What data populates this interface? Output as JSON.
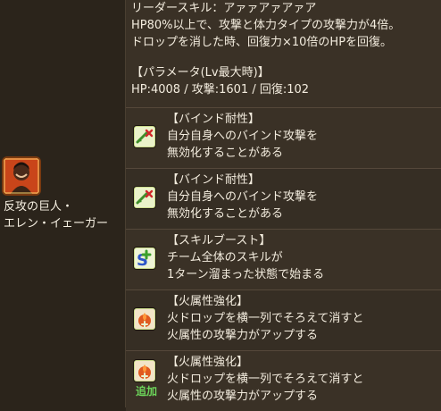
{
  "character": {
    "name_line1": "反攻の巨人・",
    "name_line2": "エレン・イェーガー"
  },
  "leader": {
    "label": "リーダースキル：アァァアァアァア",
    "line1": "HP80%以上で、攻撃と体力タイプの攻撃力が4倍。",
    "line2": "ドロップを消した時、回復力×10倍のHPを回復。"
  },
  "params": {
    "heading": "【パラメータ(Lv最大時)】",
    "stats": "HP:4008 / 攻撃:1601 / 回復:102"
  },
  "awakenings": [
    {
      "icon": "bind-resist-icon",
      "title": "【バインド耐性】",
      "desc1": "自分自身へのバインド攻撃を",
      "desc2": "無効化することがある"
    },
    {
      "icon": "bind-resist-icon",
      "title": "【バインド耐性】",
      "desc1": "自分自身へのバインド攻撃を",
      "desc2": "無効化することがある"
    },
    {
      "icon": "skill-boost-icon",
      "title": "【スキルブースト】",
      "desc1": "チーム全体のスキルが",
      "desc2": "1ターン溜まった状態で始まる"
    },
    {
      "icon": "fire-enhance-icon",
      "title": "【火属性強化】",
      "desc1": "火ドロップを横一列でそろえて消すと",
      "desc2": "火属性の攻撃力がアップする"
    },
    {
      "icon": "fire-enhance-icon",
      "title": "【火属性強化】",
      "desc1": "火ドロップを横一列でそろえて消すと",
      "desc2": "火属性の攻撃力がアップする",
      "badge": "追加"
    }
  ],
  "colors": {
    "badge_green": "#6cd45a",
    "fire_frame": "#e05a20"
  }
}
